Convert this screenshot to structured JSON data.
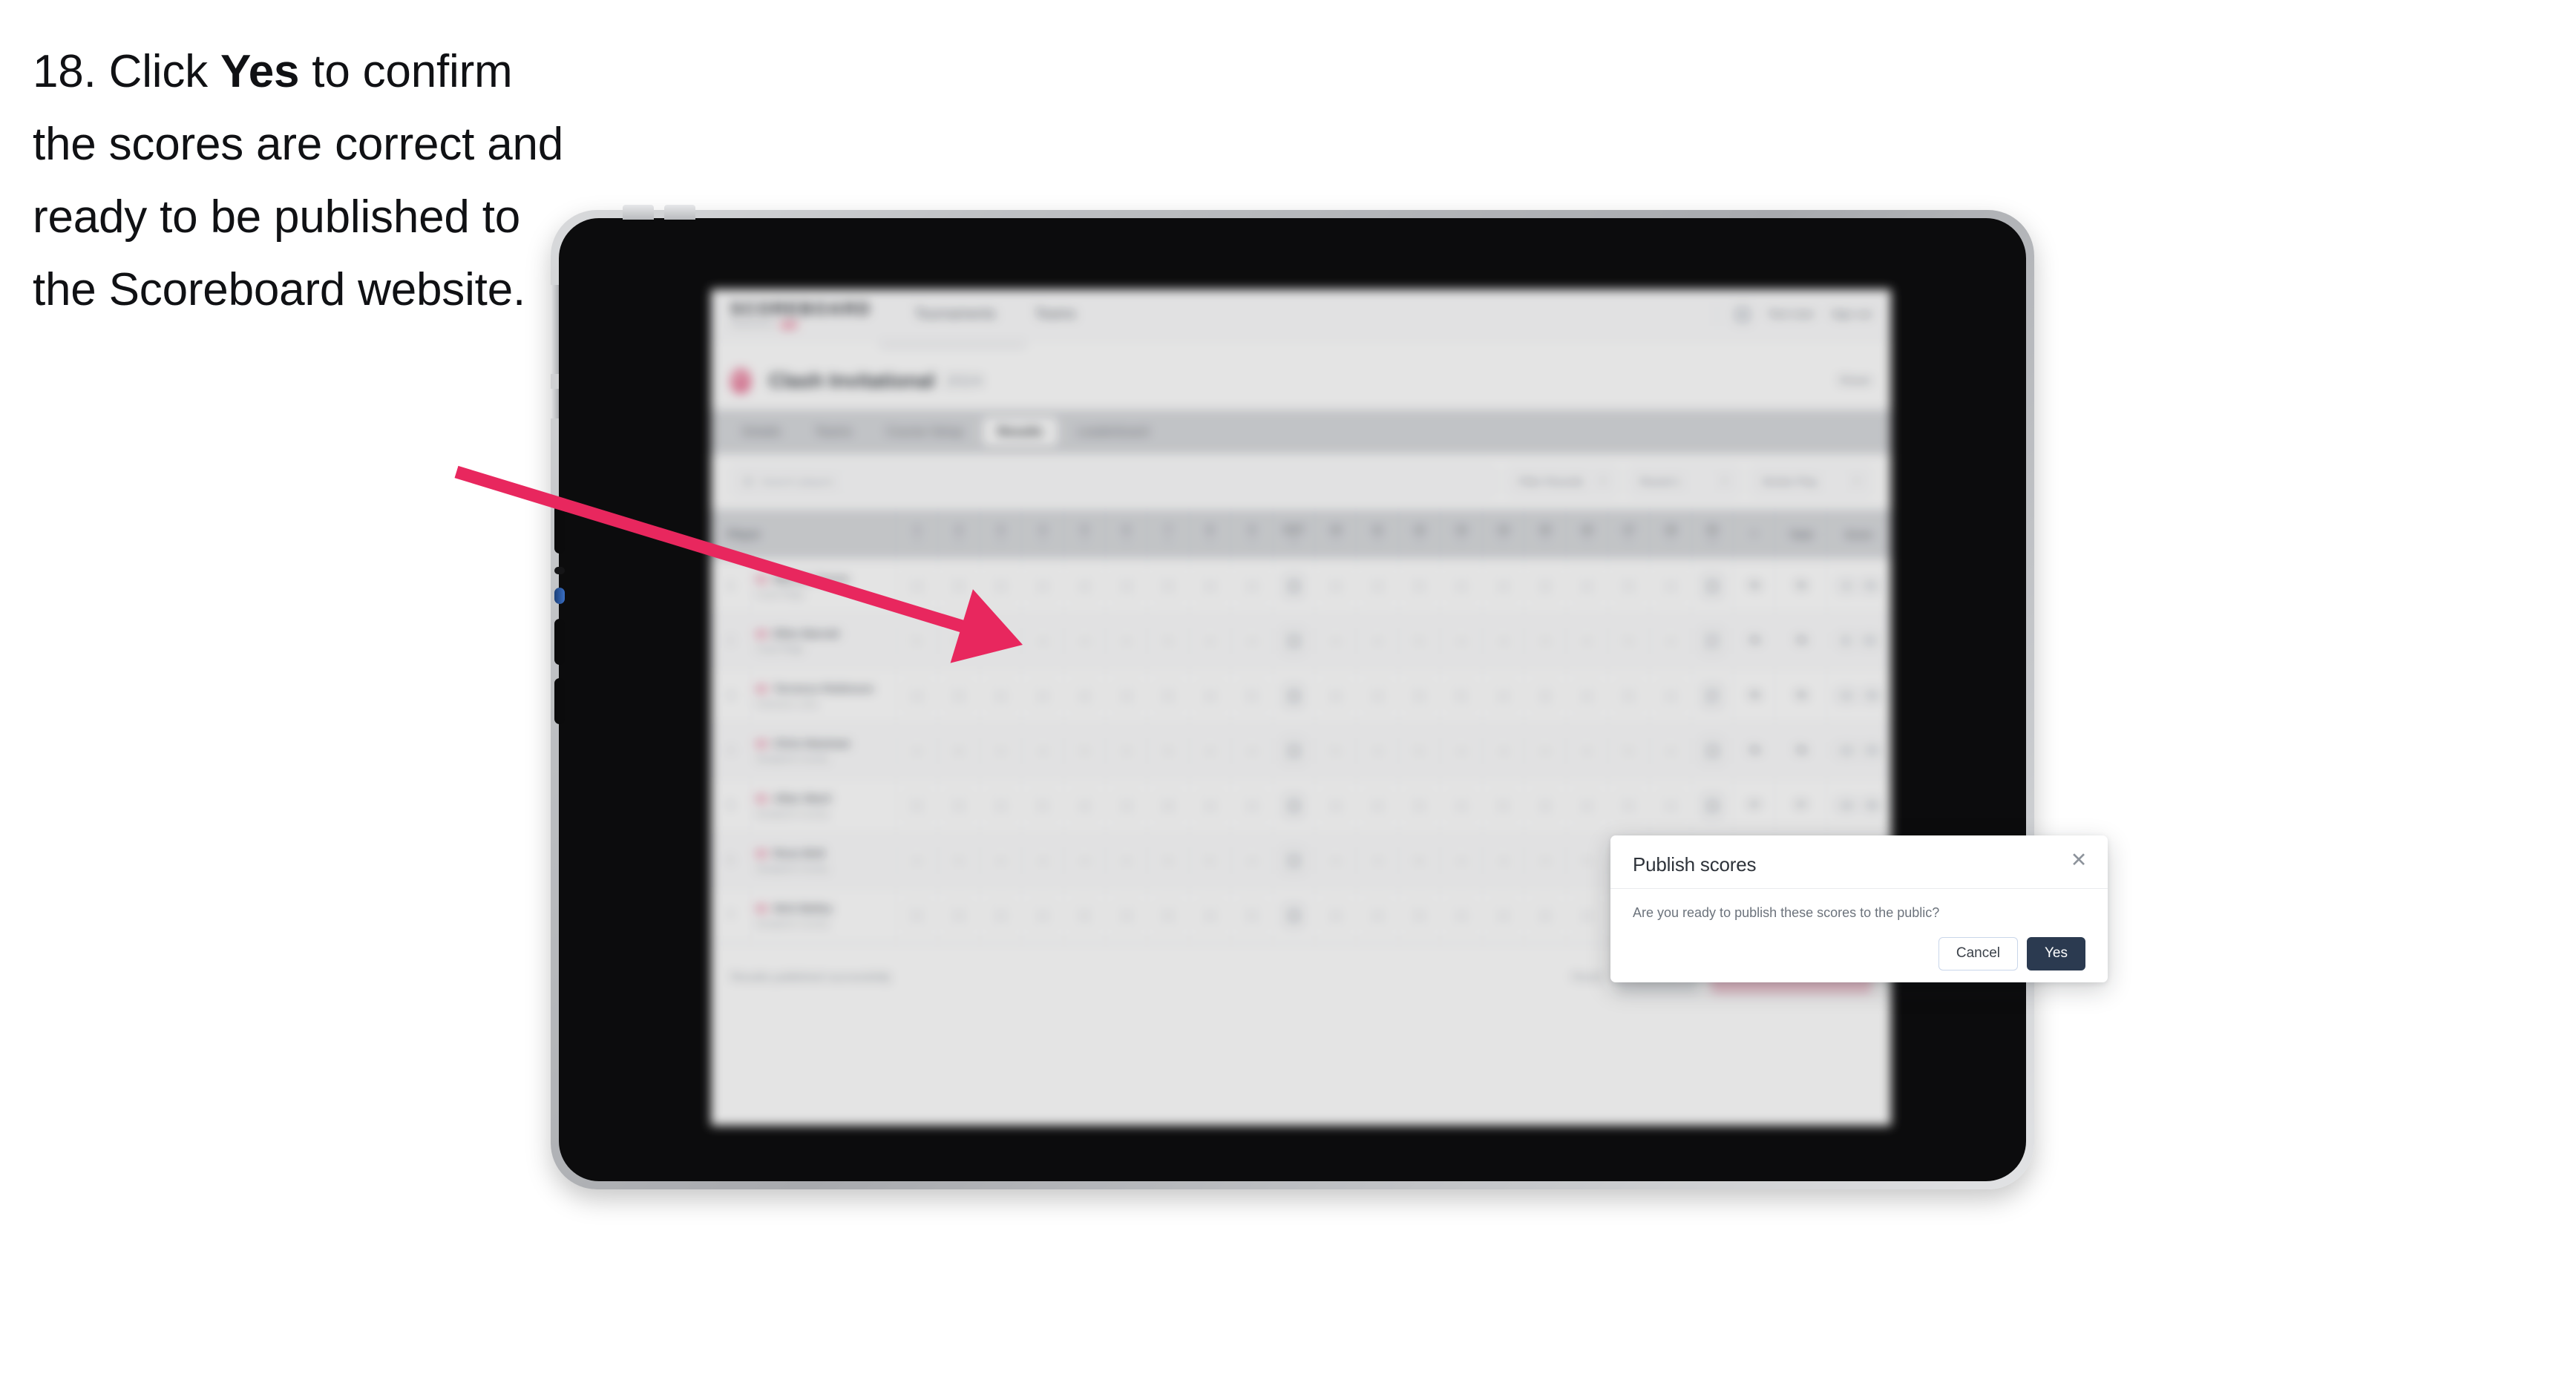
{
  "caption": {
    "number": "18.",
    "before": " Click ",
    "emphasis": "Yes",
    "after": " to confirm the scores are correct and ready to be published to the Scoreboard website."
  },
  "colors": {
    "accent_pink": "#E8275E",
    "yes_button": "#2B3A50",
    "cancel_border": "#C9D6EA",
    "brand_pink": "#EF4D7D"
  },
  "modal": {
    "title": "Publish scores",
    "message": "Are you ready to publish these scores to the public?",
    "cancel_label": "Cancel",
    "confirm_label": "Yes",
    "close_glyph": "✕"
  },
  "app": {
    "brand": {
      "word": "SCOREBOARD",
      "sub": "Powered by",
      "pill": "golf"
    },
    "nav": [
      {
        "label": "Tournaments"
      },
      {
        "label": "Teams"
      }
    ],
    "header_right": {
      "user": "Test User",
      "signout": "Sign out"
    },
    "page": {
      "title": "Clash Invitational",
      "year": "2024",
      "right_link": "Share"
    },
    "tabs": [
      {
        "label": "Details",
        "active": false
      },
      {
        "label": "Teams",
        "active": false
      },
      {
        "label": "Course Setup",
        "active": false
      },
      {
        "label": "Results",
        "active": true
      },
      {
        "label": "Leaderboard",
        "active": false
      }
    ],
    "filters": {
      "search_placeholder": "Search players",
      "select_1": "Filter Rounds",
      "select_2": "Round 1",
      "select_3": "Stroke Play"
    },
    "table": {
      "player_header": "Player",
      "hole_numbers": [
        "1",
        "2",
        "3",
        "4",
        "5",
        "6",
        "7",
        "8",
        "9",
        "OUT",
        "10",
        "11",
        "12",
        "13",
        "14",
        "15",
        "16",
        "17",
        "18",
        "IN"
      ],
      "hole_pars": [
        "4",
        "5",
        "3",
        "4",
        "4",
        "3",
        "5",
        "4",
        "4",
        "36",
        "4",
        "3",
        "5",
        "4",
        "4",
        "3",
        "4",
        "5",
        "4",
        "36"
      ],
      "narrow_header": "R",
      "total_header": "Total",
      "score_header": "Score",
      "rows": [
        {
          "pos": "1",
          "name": "Marcus Torres",
          "club": "Coast Ridge",
          "scores": [
            "4",
            "5",
            "3",
            "4",
            "4",
            "3",
            "5",
            "4",
            "4",
            "36",
            "4",
            "3",
            "5",
            "4",
            "4",
            "3",
            "4",
            "5",
            "4",
            "36"
          ],
          "r": "72",
          "total": "72",
          "score_a": "-1",
          "score_b": "71"
        },
        {
          "pos": "2",
          "name": "Ellen Barratt",
          "club": "Coast Ridge",
          "scores": [
            "5",
            "5",
            "3",
            "4",
            "4",
            "4",
            "5",
            "4",
            "4",
            "38",
            "4",
            "4",
            "5",
            "4",
            "4",
            "3",
            "4",
            "5",
            "4",
            "37"
          ],
          "r": "75",
          "total": "75",
          "score_a": "E",
          "score_b": "72"
        },
        {
          "pos": "3",
          "name": "Terrence Robinson",
          "club": "Fairhaven Links",
          "scores": [
            "4",
            "5",
            "4",
            "4",
            "4",
            "3",
            "5",
            "4",
            "5",
            "38",
            "4",
            "3",
            "5",
            "5",
            "4",
            "3",
            "4",
            "5",
            "4",
            "37"
          ],
          "r": "75",
          "total": "75",
          "score_a": "+1",
          "score_b": "73"
        },
        {
          "pos": "4",
          "name": "Chris Newman",
          "club": "Sandpoint Country",
          "scores": [
            "4",
            "6",
            "3",
            "4",
            "5",
            "3",
            "5",
            "4",
            "4",
            "38",
            "5",
            "3",
            "5",
            "4",
            "4",
            "4",
            "4",
            "5",
            "4",
            "38"
          ],
          "r": "76",
          "total": "76",
          "score_a": "+2",
          "score_b": "74"
        },
        {
          "pos": "5",
          "name": "Allan Ward",
          "club": "Sandpoint Country",
          "scores": [
            "5",
            "5",
            "3",
            "5",
            "4",
            "3",
            "6",
            "4",
            "4",
            "39",
            "4",
            "4",
            "5",
            "4",
            "5",
            "3",
            "4",
            "5",
            "4",
            "38"
          ],
          "r": "77",
          "total": "77",
          "score_a": "+4",
          "score_b": "76"
        },
        {
          "pos": "6",
          "name": "Ross Bolt",
          "club": "Sandpoint Country",
          "scores": [
            "4",
            "5",
            "4",
            "4",
            "4",
            "4",
            "5",
            "5",
            "4",
            "39",
            "4",
            "3",
            "6",
            "4",
            "4",
            "3",
            "5",
            "5",
            "4",
            "38"
          ],
          "r": "77",
          "total": "77",
          "score_a": "+5",
          "score_b": "77"
        },
        {
          "pos": "7",
          "name": "Nick Bailey",
          "club": "Sandpoint Country",
          "scores": [
            "5",
            "5",
            "3",
            "4",
            "5",
            "3",
            "5",
            "4",
            "5",
            "39",
            "4",
            "4",
            "5",
            "4",
            "4",
            "4",
            "4",
            "6",
            "4",
            "39"
          ],
          "r": "78",
          "total": "78",
          "score_a": "+6",
          "score_b": "78"
        }
      ]
    },
    "bottom_bar": {
      "status": "Results published successfully",
      "link": "Reset",
      "secondary_button": "Save all",
      "primary_button": "Publish to Scoreboard"
    }
  }
}
